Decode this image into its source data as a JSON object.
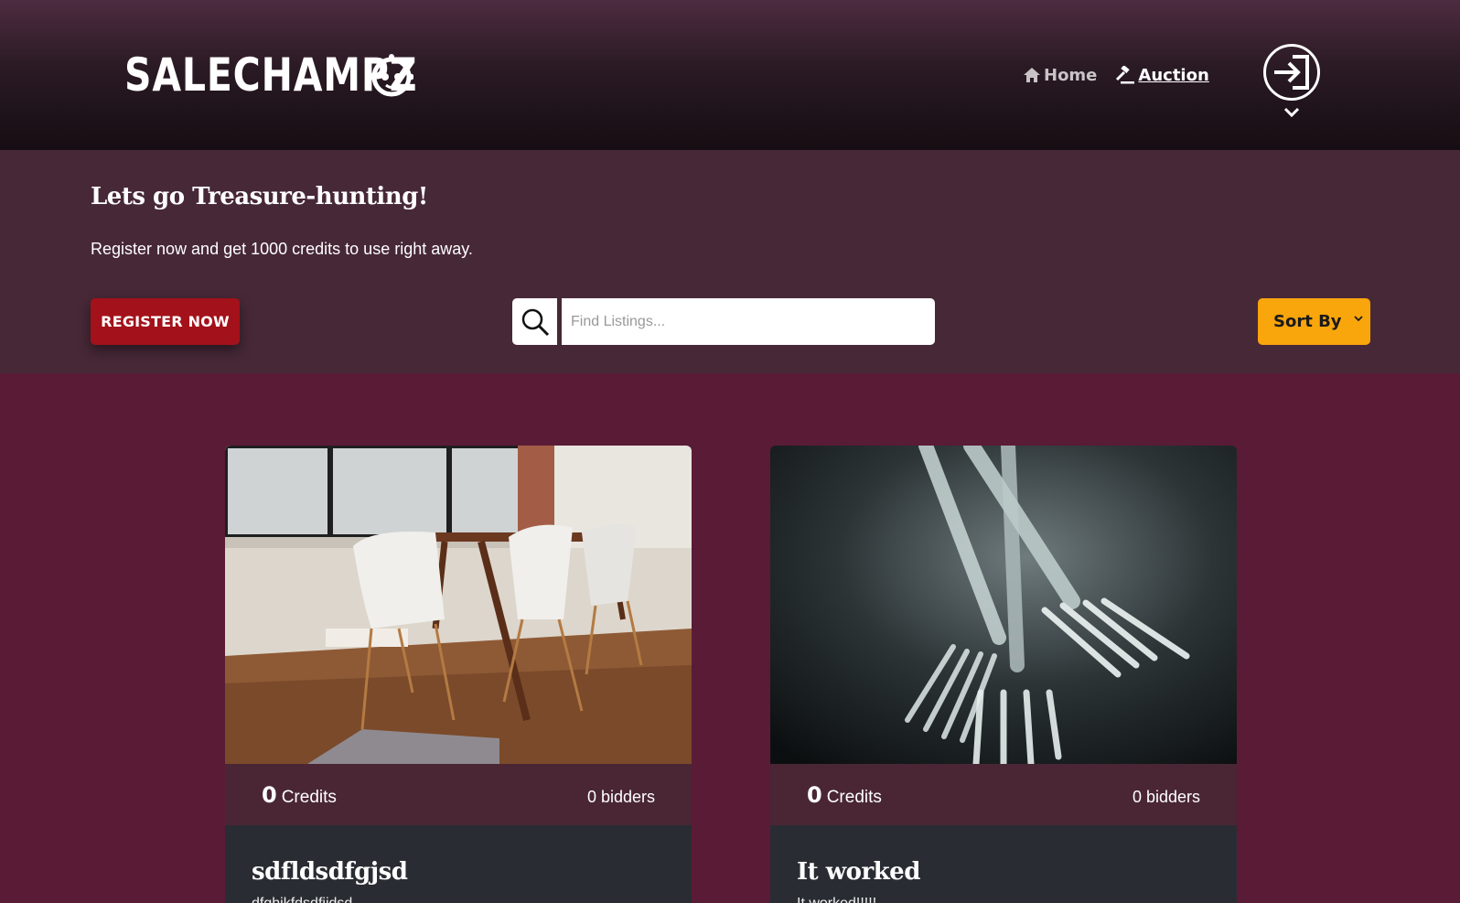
{
  "brand": {
    "name": "SALECHAMPZ"
  },
  "nav": {
    "items": [
      {
        "label": "Home",
        "icon": "home-icon",
        "active": false
      },
      {
        "label": "Auction",
        "icon": "gavel-icon",
        "active": true
      }
    ]
  },
  "hero": {
    "title": "Lets go Treasure-hunting!",
    "subtitle": "Register now and get 1000 credits to use right away.",
    "register_label": "REGISTER NOW"
  },
  "search": {
    "placeholder": "Find Listings..."
  },
  "sort": {
    "label": "Sort By"
  },
  "colors": {
    "page_bg": "#5a1b37",
    "hero_bg": "#472837",
    "register": "#a3111a",
    "sort": "#f9a50c",
    "stats_bg": "#4a2635",
    "body_bg": "#2a2c33"
  },
  "listings": [
    {
      "image": "dining-room-chairs-photo",
      "credits_value": "0",
      "credits_label": "Credits",
      "bidders": "0 bidders",
      "title": "sdfldsdfgjsd",
      "description": "dfghjkfdsdfjjdsd"
    },
    {
      "image": "forks-photo",
      "credits_value": "0",
      "credits_label": "Credits",
      "bidders": "0 bidders",
      "title": "It worked",
      "description": "It worked!!!!!"
    }
  ]
}
